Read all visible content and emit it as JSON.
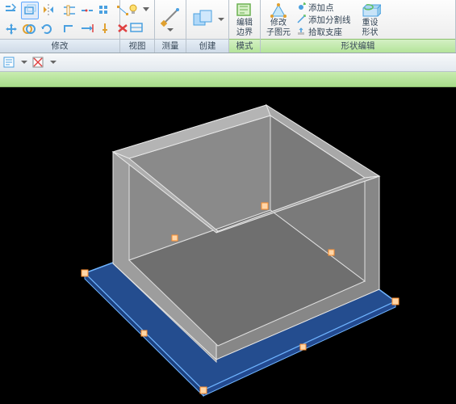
{
  "ribbon": {
    "panels": {
      "modify": {
        "label": "修改"
      },
      "view": {
        "label": "视图"
      },
      "measure": {
        "label": "测量"
      },
      "create": {
        "label": "创建"
      },
      "mode": {
        "label": "模式"
      },
      "shape_edit": {
        "label": "形状编辑"
      }
    },
    "buttons": {
      "edit_boundary_l1": "编辑",
      "edit_boundary_l2": "边界",
      "edit_sub_l1": "修改",
      "edit_sub_l2": "子图元",
      "add_point": "添加点",
      "add_split_line": "添加分割线",
      "pick_supports": "拾取支座",
      "reset_shape_l1": "重设",
      "reset_shape_l2": "形状"
    }
  }
}
